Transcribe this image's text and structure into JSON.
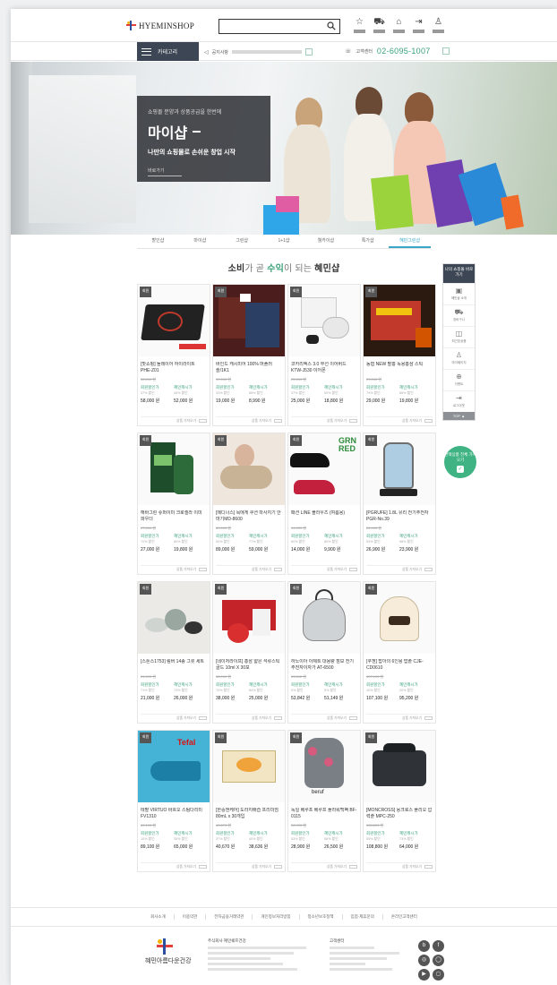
{
  "header": {
    "logo_text": "HYEMINSHOP",
    "search_placeholder": "",
    "icons": [
      {
        "name": "star-icon",
        "glyph": "☆"
      },
      {
        "name": "cart-icon",
        "glyph": "⛟"
      },
      {
        "name": "home-icon",
        "glyph": "⌂"
      },
      {
        "name": "logout-icon",
        "glyph": "⇥"
      },
      {
        "name": "user-icon",
        "glyph": "♙"
      }
    ]
  },
  "nav": {
    "category_label": "카테고리",
    "notice_label": "공지사항",
    "cs_label": "고객센터",
    "phone": "02-6095-1007"
  },
  "hero": {
    "subtitle": "쇼핑몰 분양과 상품공급을 한번에",
    "title": "마이샵",
    "description": "나만의 쇼핑몰로 손쉬운 창업 시작",
    "more": "바로가기"
  },
  "tabs": [
    "할인샵",
    "마이샵",
    "그린샵",
    "1+1샵",
    "웰카이샵",
    "특가샵",
    "혜민그린샵"
  ],
  "active_tab_index": 6,
  "section": {
    "title_a": "소비",
    "title_b": "가 곧 ",
    "title_c": "수익",
    "title_d": "이 되는 ",
    "title_e": "혜민샵"
  },
  "card_labels": {
    "badge": "회원",
    "sale": "회원할인가",
    "member": "혜민캐시가",
    "cart": "상품 가져오기"
  },
  "products": [
    {
      "name": "[핫쇼핑] 돌레이어 하이라이트 PHE-Z01",
      "p1": "58,000 원",
      "p2": "52,000 원",
      "pct1": "37% 할인",
      "pct2": "45% 할인"
    },
    {
      "name": "바인드 캐시미어 100% 머플러 숄/1K1",
      "p1": "19,000 원",
      "p2": "8,990 원",
      "pct1": "33% 할인",
      "pct2": "85% 할인"
    },
    {
      "name": "코카리엑스 3.0 무선 이어버드 KTW-J530 이어폰",
      "p1": "25,000 원",
      "p2": "18,800 원",
      "pct1": "37% 할인",
      "pct2": "50% 할인"
    },
    {
      "name": "농협 NEW 팔홍 녹용홍삼 스틱",
      "p1": "29,000 원",
      "p2": "19,800 원",
      "pct1": "79% 할인",
      "pct2": "86% 할인"
    },
    {
      "name": "해바그린 슈퍼이미 크로렐라 이미 파우더",
      "p1": "27,000 원",
      "p2": "19,800 원",
      "pct1": "70% 할인",
      "pct2": "80% 할인"
    },
    {
      "name": "[메디너스] 목에게 쿠션 마사지기 안마기MD-8600",
      "p1": "89,000 원",
      "p2": "59,000 원",
      "pct1": "50% 할인",
      "pct2": "77% 할인"
    },
    {
      "name": "패션 LINE 블라우즈 (여름용)",
      "p1": "14,000 원",
      "p2": "9,900 원",
      "pct1": "60% 할인",
      "pct2": "80% 할인"
    },
    {
      "name": "[PGRUFE] 1.8L 유리 전기주전자 PGR-No.39",
      "p1": "26,900 원",
      "p2": "23,900 원",
      "pct1": "53% 할인",
      "pct2": "58% 할인"
    },
    {
      "name": "[스톤스1753] 림버 14종 그릇 세트",
      "p1": "21,000 원",
      "p2": "26,000 원",
      "pct1": "71% 할인",
      "pct2": "73% 할인"
    },
    {
      "name": "[네이처라이프] 홍삼 얇은 석류스틱 골드 10ml X 30포",
      "p1": "38,000 원",
      "p2": "25,000 원",
      "pct1": "70% 할인",
      "pct2": "84% 할인"
    },
    {
      "name": "하노이아 아제트 대용량 점보 전기주전자이자가 AT-6500",
      "p1": "53,842 원",
      "p2": "51,149 원",
      "pct1": "0% 할인",
      "pct2": "5% 할인"
    },
    {
      "name": "[쿠첸] 밥아의 6인용 밥솥 CJE-CD0610",
      "p1": "107,100 원",
      "p2": "95,200 원",
      "pct1": "10% 할인",
      "pct2": "20% 할인"
    },
    {
      "name": "테팔 VIRTUO 바흐오 스팀다리미 FV1310",
      "p1": "89,100 원",
      "p2": "65,000 원",
      "pct1": "10% 할인",
      "pct2": "35% 할인"
    },
    {
      "name": "[한중앤케어] 도라지배즙 프리미엄 80mL x 30개입",
      "p1": "40,670 원",
      "p2": "38,636 원",
      "pct1": "37% 할인",
      "pct2": "40% 할인"
    },
    {
      "name": "독일 베루프 베루프 플라워백팩 BF-0115",
      "p1": "28,900 원",
      "p2": "26,500 원",
      "pct1": "53% 할인",
      "pct2": "58% 할인"
    },
    {
      "name": "[MONCROSS] 몽크로스 플리오 압력솥 MPC-250",
      "p1": "108,800 원",
      "p2": "64,000 원",
      "pct1": "55% 할인",
      "pct2": "73% 할인"
    }
  ],
  "right_sidebar": {
    "head": "나의 쇼핑몰 바로가기",
    "items": [
      {
        "label": "혜민샵 소개",
        "glyph": "▣"
      },
      {
        "label": "장바구니",
        "glyph": "⛟"
      },
      {
        "label": "최근본상품",
        "glyph": "◫"
      },
      {
        "label": "마이페이지",
        "glyph": "♙"
      },
      {
        "label": "이벤트",
        "glyph": "⊕"
      },
      {
        "label": "로그아웃",
        "glyph": "⇥"
      }
    ],
    "top": "TOP ▲"
  },
  "consult": {
    "text": "선택상품 전체 가져오기",
    "icon": "✓"
  },
  "footer": {
    "links": [
      "회사소개",
      "이용약관",
      "전자금융거래약관",
      "개인정보처리방침",
      "청소년보호정책",
      "입점·제휴문의",
      "온라인고객센터"
    ],
    "logo_text": "혜민아름다운건강",
    "company_label": "주식회사 혜민쉐프건강",
    "cs_label": "고객센터",
    "social": [
      "b",
      "f",
      "◎",
      "◯",
      "▶",
      "◻"
    ]
  },
  "colors": {
    "accent": "#3aa17a",
    "dark": "#3d4654",
    "tab_active": "#3aa7c8"
  }
}
